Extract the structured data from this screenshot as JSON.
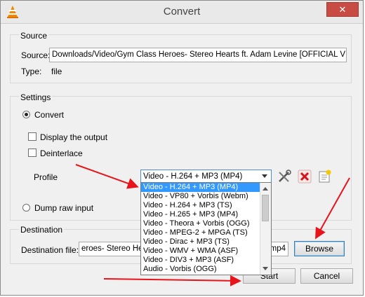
{
  "window": {
    "title": "Convert",
    "close_label": "✕"
  },
  "source": {
    "group_title": "Source",
    "source_label": "Source:",
    "source_value": "Downloads/Video/Gym Class Heroes- Stereo Hearts ft. Adam Levine [OFFICIAL VIDEO].",
    "type_label": "Type:",
    "type_value": "file"
  },
  "settings": {
    "group_title": "Settings",
    "convert_label": "Convert",
    "display_output_label": "Display the output",
    "deinterlace_label": "Deinterlace",
    "profile_label": "Profile",
    "profile_selected": "Video - H.264 + MP3 (MP4)",
    "dump_raw_label": "Dump raw input"
  },
  "profile_options": [
    "Video - H.264 + MP3 (MP4)",
    "Video - VP80 + Vorbis (Webm)",
    "Video - H.264 + MP3 (TS)",
    "Video - H.265 + MP3 (MP4)",
    "Video - Theora + Vorbis (OGG)",
    "Video - MPEG-2 + MPGA (TS)",
    "Video - Dirac + MP3 (TS)",
    "Video - WMV + WMA (ASF)",
    "Video - DIV3 + MP3 (ASF)",
    "Audio - Vorbis (OGG)"
  ],
  "destination": {
    "group_title": "Destination",
    "file_label": "Destination file:",
    "file_value_left": "eroes- Stereo Hea",
    "file_value_right": "mp4",
    "browse_label": "Browse"
  },
  "buttons": {
    "start_label": "Start",
    "cancel_label": "Cancel"
  },
  "colors": {
    "annotation_arrow": "#e8141c",
    "selection": "#3399ff",
    "close_button": "#c84c43"
  }
}
